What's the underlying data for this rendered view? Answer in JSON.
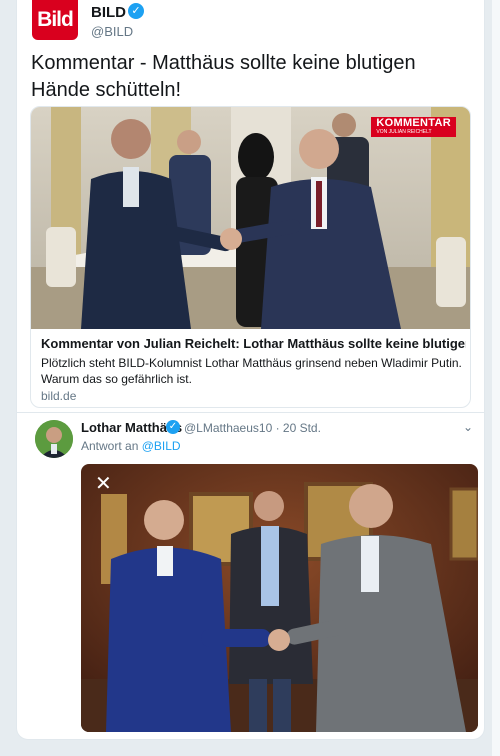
{
  "tweet": {
    "logo_text": "Bild",
    "name": "BILD",
    "handle": "@BILD",
    "text": "Kommentar - Matthäus sollte keine blutigen Hände schütteln!",
    "card": {
      "badge_title": "KOMMENTAR",
      "badge_sub": "VON JULIAN REICHELT",
      "title": "Kommentar von Julian Reichelt: Lothar Matthäus sollte keine blutigen Hände...",
      "description": "Plötzlich steht BILD-Kolumnist Lothar Matthäus grinsend neben Wladimir Putin. Warum das so gefährlich ist.",
      "domain": "bild.de"
    }
  },
  "reply": {
    "name": "Lothar Matthäus",
    "handle_time": "@LMatthaeus10 · 20 Std.",
    "reply_prefix": "Antwort an",
    "reply_to": "@BILD",
    "close_glyph": "✕",
    "caret_glyph": "⌄"
  },
  "icons": {
    "verified": "verified-badge-icon",
    "close": "close-icon",
    "caret": "chevron-down-icon"
  },
  "colors": {
    "brand_red": "#d9001e",
    "twitter_blue": "#1da1f2",
    "muted": "#657786"
  }
}
